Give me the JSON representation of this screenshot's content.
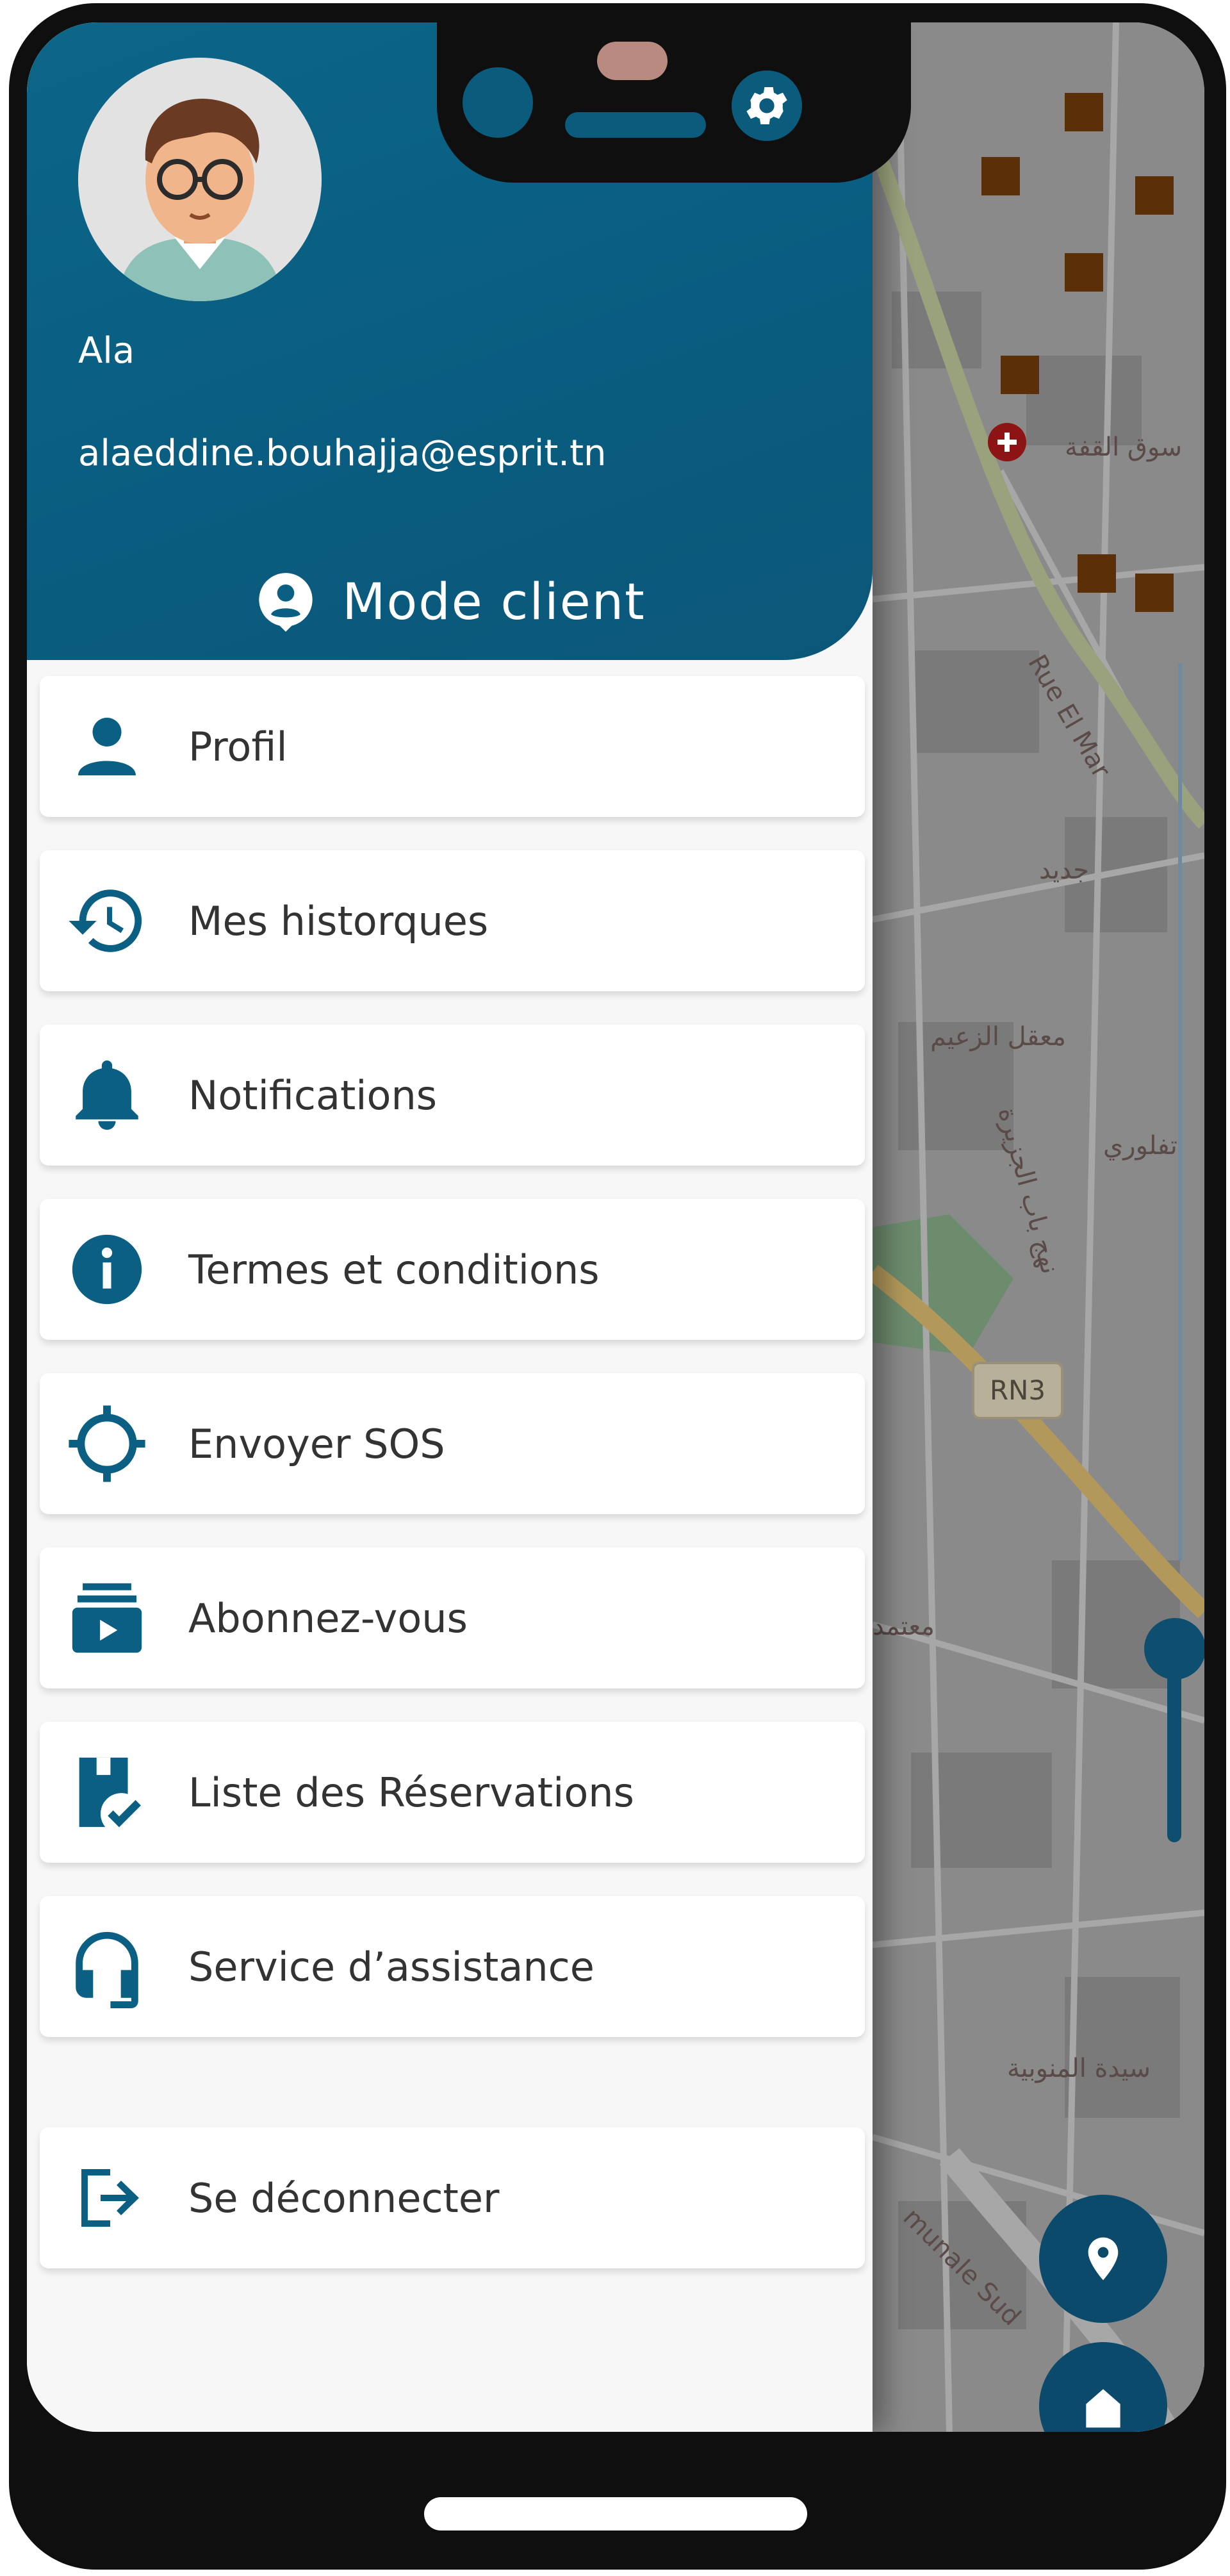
{
  "user": {
    "name": "Ala",
    "email": "alaeddine.bouhajja@esprit.tn"
  },
  "mode": {
    "label": "Mode client",
    "icon": "account-pin-icon"
  },
  "menu": [
    {
      "label": "Profil",
      "icon": "person-icon"
    },
    {
      "label": "Mes historques",
      "icon": "history-icon"
    },
    {
      "label": "Notifications",
      "icon": "bell-icon"
    },
    {
      "label": "Termes et conditions",
      "icon": "info-icon"
    },
    {
      "label": "Envoyer SOS",
      "icon": "crosshair-icon"
    },
    {
      "label": "Abonnez-vous",
      "icon": "subscriptions-icon"
    },
    {
      "label": "Liste des Réservations",
      "icon": "reservation-list-icon"
    },
    {
      "label": "Service d’assistance",
      "icon": "headset-icon"
    },
    {
      "label": "Se déconnecter",
      "icon": "logout-icon"
    }
  ],
  "map": {
    "road_badge": "RN3",
    "labels": [
      "سوق القفة",
      "Rue El Mar",
      "معقل الزعيم",
      "نهج باب الجزيرة",
      "تفلوري",
      "معتمد",
      "سيدة المنوبية",
      "munale Sud",
      "جديد"
    ]
  },
  "colors": {
    "primary": "#0a5f83",
    "accent_dark": "#0b4a6a",
    "menu_text": "#333333"
  }
}
